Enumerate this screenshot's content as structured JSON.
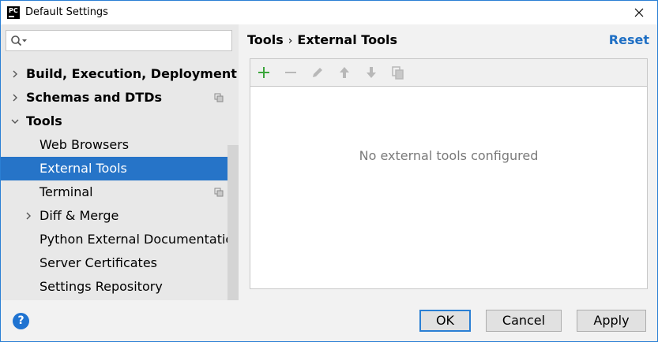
{
  "window": {
    "app_icon_text": "PC",
    "title": "Default Settings"
  },
  "search": {
    "placeholder": "",
    "value": ""
  },
  "tree": [
    {
      "label": "Build, Execution, Deployment",
      "bold": true,
      "expandable": true,
      "expanded": false
    },
    {
      "label": "Schemas and DTDs",
      "bold": true,
      "expandable": true,
      "expanded": false,
      "has_copy_icon": true
    },
    {
      "label": "Tools",
      "bold": true,
      "expandable": true,
      "expanded": true
    },
    {
      "label": "Web Browsers"
    },
    {
      "label": "External Tools",
      "selected": true
    },
    {
      "label": "Terminal",
      "has_copy_icon": true
    },
    {
      "label": "Diff & Merge",
      "expandable": true,
      "expanded": false
    },
    {
      "label": "Python External Documentatio"
    },
    {
      "label": "Server Certificates"
    },
    {
      "label": "Settings Repository"
    }
  ],
  "breadcrumb": {
    "parent": "Tools",
    "separator": "›",
    "current": "External Tools"
  },
  "reset_label": "Reset",
  "toolbar_icons": [
    "add-icon",
    "remove-icon",
    "edit-icon",
    "move-up-icon",
    "move-down-icon",
    "copy-icon"
  ],
  "empty_message": "No external tools configured",
  "buttons": {
    "help": "?",
    "ok": "OK",
    "cancel": "Cancel",
    "apply": "Apply"
  },
  "colors": {
    "selection": "#2674c8",
    "link": "#1f6fc4",
    "add_green": "#3ca63c",
    "border_blue": "#2a7fd4"
  }
}
